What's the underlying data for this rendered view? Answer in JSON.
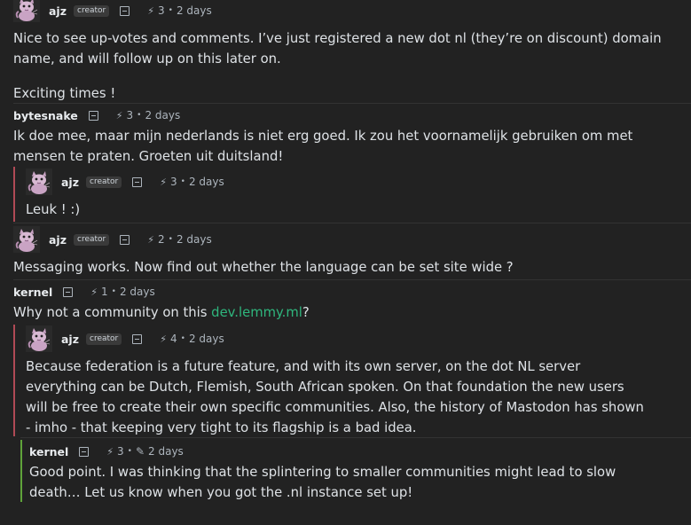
{
  "comments": [
    {
      "author": "ajz",
      "badge": "creator",
      "score": "3",
      "age": "2 days",
      "body": [
        "Nice to see up-votes and comments. I’ve just registered a new dot nl (they’re on discount) domain name, and will follow up on this later on.",
        "Exciting times !"
      ]
    },
    {
      "author": "bytesnake",
      "score": "3",
      "age": "2 days",
      "body": "Ik doe mee, maar mijn nederlands is niet erg goed. Ik zou het voornamelijk gebruiken om met mensen te praten. Groeten uit duitsland!"
    },
    {
      "author": "ajz",
      "badge": "creator",
      "score": "3",
      "age": "2 days",
      "body": "Leuk ! :)"
    },
    {
      "author": "ajz",
      "badge": "creator",
      "score": "2",
      "age": "2 days",
      "body": "Messaging works. Now find out whether the language can be set site wide ?"
    },
    {
      "author": "kernel",
      "score": "1",
      "age": "2 days",
      "body_prefix": "Why not a community on this ",
      "link": "dev.lemmy.ml",
      "body_suffix": "?"
    },
    {
      "author": "ajz",
      "badge": "creator",
      "score": "4",
      "age": "2 days",
      "body": "Because federation is a future feature, and with its own server, on the dot NL server everything can be Dutch, Flemish, South African spoken. On that foundation the new users will be free to create their own specific communities. Also, the history of Mastodon has shown - imho - that keeping very tight to its flagship is a bad idea."
    },
    {
      "author": "kernel",
      "score": "3",
      "age": "2 days",
      "body": "Good point. I was thinking that the splintering to smaller communities might lead to slow death… Let us know when you got the .nl instance set up!"
    }
  ],
  "icons": {
    "vote": "bolt-icon",
    "collapse": "collapse-icon",
    "edited": "pencil-icon",
    "avatar": "cat-avatar"
  },
  "colors": {
    "background": "#222222",
    "link": "#2fb67d",
    "thread_bar_red": "#b04a55",
    "thread_bar_green": "#5fa33a"
  }
}
